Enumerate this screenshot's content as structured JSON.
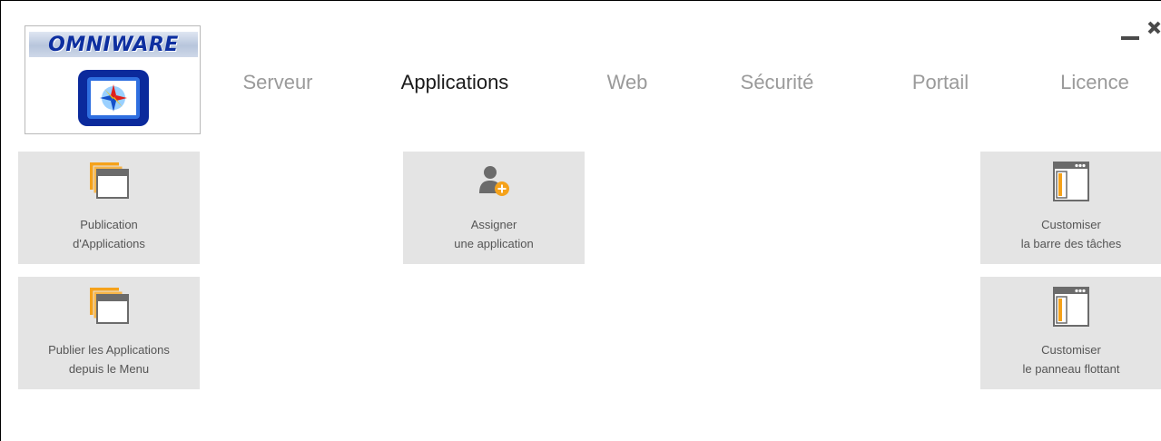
{
  "logo": {
    "text": "OMNIWARE"
  },
  "window_controls": {
    "minimize": "minimize-icon",
    "close": "close-icon"
  },
  "tabs": [
    {
      "label": "Serveur",
      "active": false
    },
    {
      "label": "Applications",
      "active": true
    },
    {
      "label": "Web",
      "active": false
    },
    {
      "label": "Sécurité",
      "active": false
    },
    {
      "label": "Portail",
      "active": false
    },
    {
      "label": "Licence",
      "active": false
    }
  ],
  "tiles": {
    "publication": {
      "line1": "Publication",
      "line2": "d'Applications",
      "icon": "windows-stack-icon"
    },
    "assign": {
      "line1": "Assigner",
      "line2": "une application",
      "icon": "add-user-icon"
    },
    "taskbar": {
      "line1": "Customiser",
      "line2": "la barre des tâches",
      "icon": "window-panel-icon"
    },
    "publish_menu": {
      "line1": "Publier les Applications",
      "line2": "depuis le Menu",
      "icon": "windows-stack-icon"
    },
    "floating_panel": {
      "line1": "Customiser",
      "line2": "le panneau flottant",
      "icon": "window-panel-icon"
    }
  },
  "colors": {
    "accent_orange": "#f5a21b",
    "tile_bg": "#e4e4e4",
    "logo_blue": "#0d2fa0"
  }
}
